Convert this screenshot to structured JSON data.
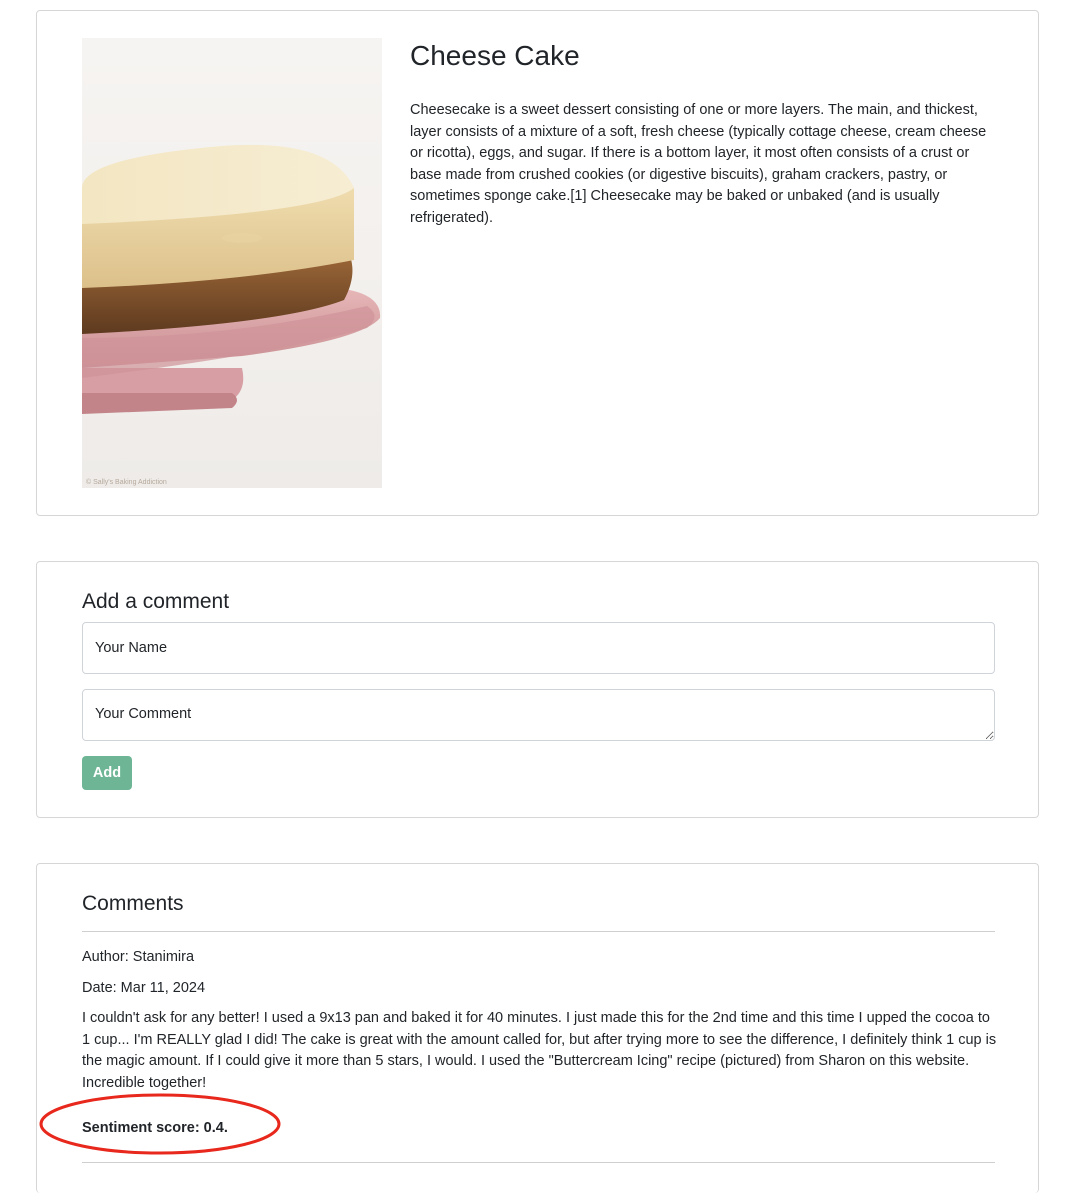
{
  "recipe": {
    "title": "Cheese Cake",
    "description": "Cheesecake is a sweet dessert consisting of one or more layers. The main, and thickest, layer consists of a mixture of a soft, fresh cheese (typically cottage cheese, cream cheese or ricotta), eggs, and sugar. If there is a bottom layer, it most often consists of a crust or base made from crushed cookies (or digestive biscuits), graham crackers, pastry, or sometimes sponge cake.[1] Cheesecake may be baked or unbaked (and is usually refrigerated).",
    "image_watermark": "© Sally's Baking Addiction"
  },
  "comment_form": {
    "title": "Add a comment",
    "name_placeholder": "Your Name",
    "comment_placeholder": "Your Comment",
    "add_label": "Add"
  },
  "comments": {
    "title": "Comments",
    "items": [
      {
        "author_line": "Author: Stanimira",
        "date_line": "Date: Mar 11, 2024",
        "text": "I couldn't ask for any better! I used a 9x13 pan and baked it for 40 minutes. I just made this for the 2nd time and this time I upped the cocoa to 1 cup... I'm REALLY glad I did! The cake is great with the amount called for, but after trying more to see the difference, I definitely think 1 cup is the magic amount. If I could give it more than 5 stars, I would. I used the \"Buttercream Icing\" recipe (pictured) from Sharon on this website. Incredible together!",
        "sentiment_line": "Sentiment score: 0.4."
      }
    ]
  },
  "colors": {
    "accent_button": "#6db594",
    "annotation": "#e8281c",
    "card_border": "#d6d6d6"
  }
}
